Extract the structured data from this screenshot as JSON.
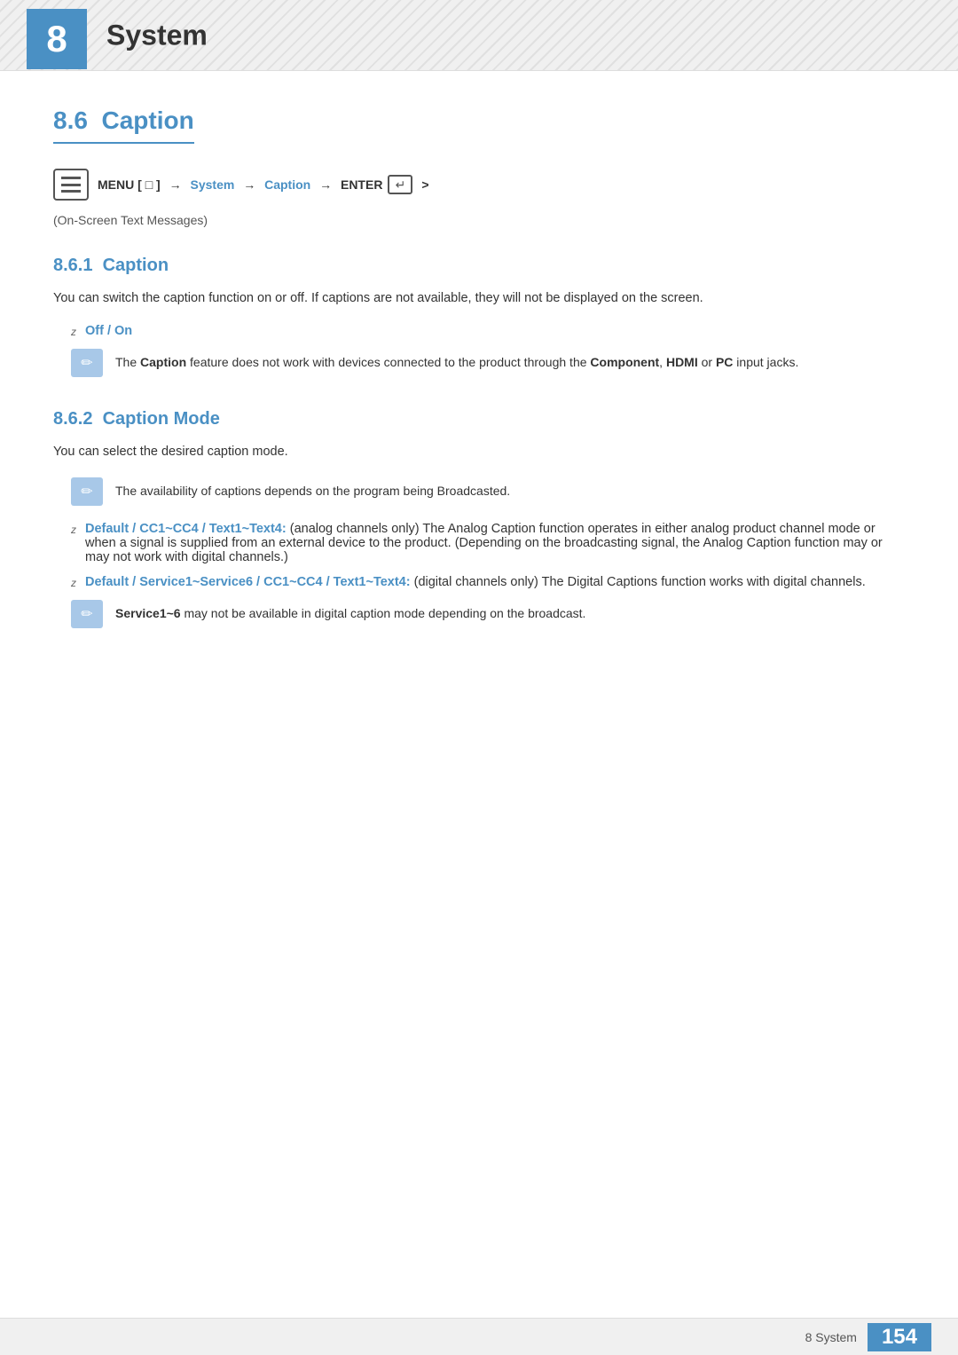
{
  "header": {
    "chapter_number": "8",
    "chapter_title": "System"
  },
  "section": {
    "number": "8.6",
    "title": "Caption"
  },
  "nav": {
    "menu_label": "MENU",
    "bracket_open": "[",
    "bracket_close": "]",
    "arrow1": "→",
    "system": "System",
    "arrow2": "→",
    "caption": "Caption",
    "arrow3": "→",
    "enter": "ENTER",
    "arrow4": ">"
  },
  "on_screen_label": "(On-Screen Text Messages)",
  "subsection1": {
    "number": "8.6.1",
    "title": "Caption",
    "body": "You can switch the caption function on or off. If captions are not available, they will not be displayed on the screen.",
    "bullet_label": "Off / On",
    "note_text": "The Caption feature does not work with devices connected to the product through the Component, HDMI or PC input jacks.",
    "note_caption": "Caption",
    "note_component": "Component",
    "note_hdmi": "HDMI",
    "note_pc": "PC"
  },
  "subsection2": {
    "number": "8.6.2",
    "title": "Caption Mode",
    "body": "You can select the desired caption mode.",
    "note1_text": "The availability of captions depends on the program being Broadcasted.",
    "bullet1_label": "Default / CC1~CC4 / Text1~Text4:",
    "bullet1_text": "(analog channels only) The Analog Caption function operates in either analog product channel mode or when a signal is supplied from an external device to the product. (Depending on the broadcasting signal, the Analog Caption function may or may not work with digital channels.)",
    "bullet2_label": "Default / Service1~Service6 / CC1~CC4 / Text1~Text4:",
    "bullet2_text": "(digital channels only) The Digital Captions function works with digital channels.",
    "note2_text": "Service1~6 may not be available in digital caption mode depending on the broadcast.",
    "note2_service": "Service1~6"
  },
  "footer": {
    "label": "8 System",
    "page_number": "154"
  }
}
